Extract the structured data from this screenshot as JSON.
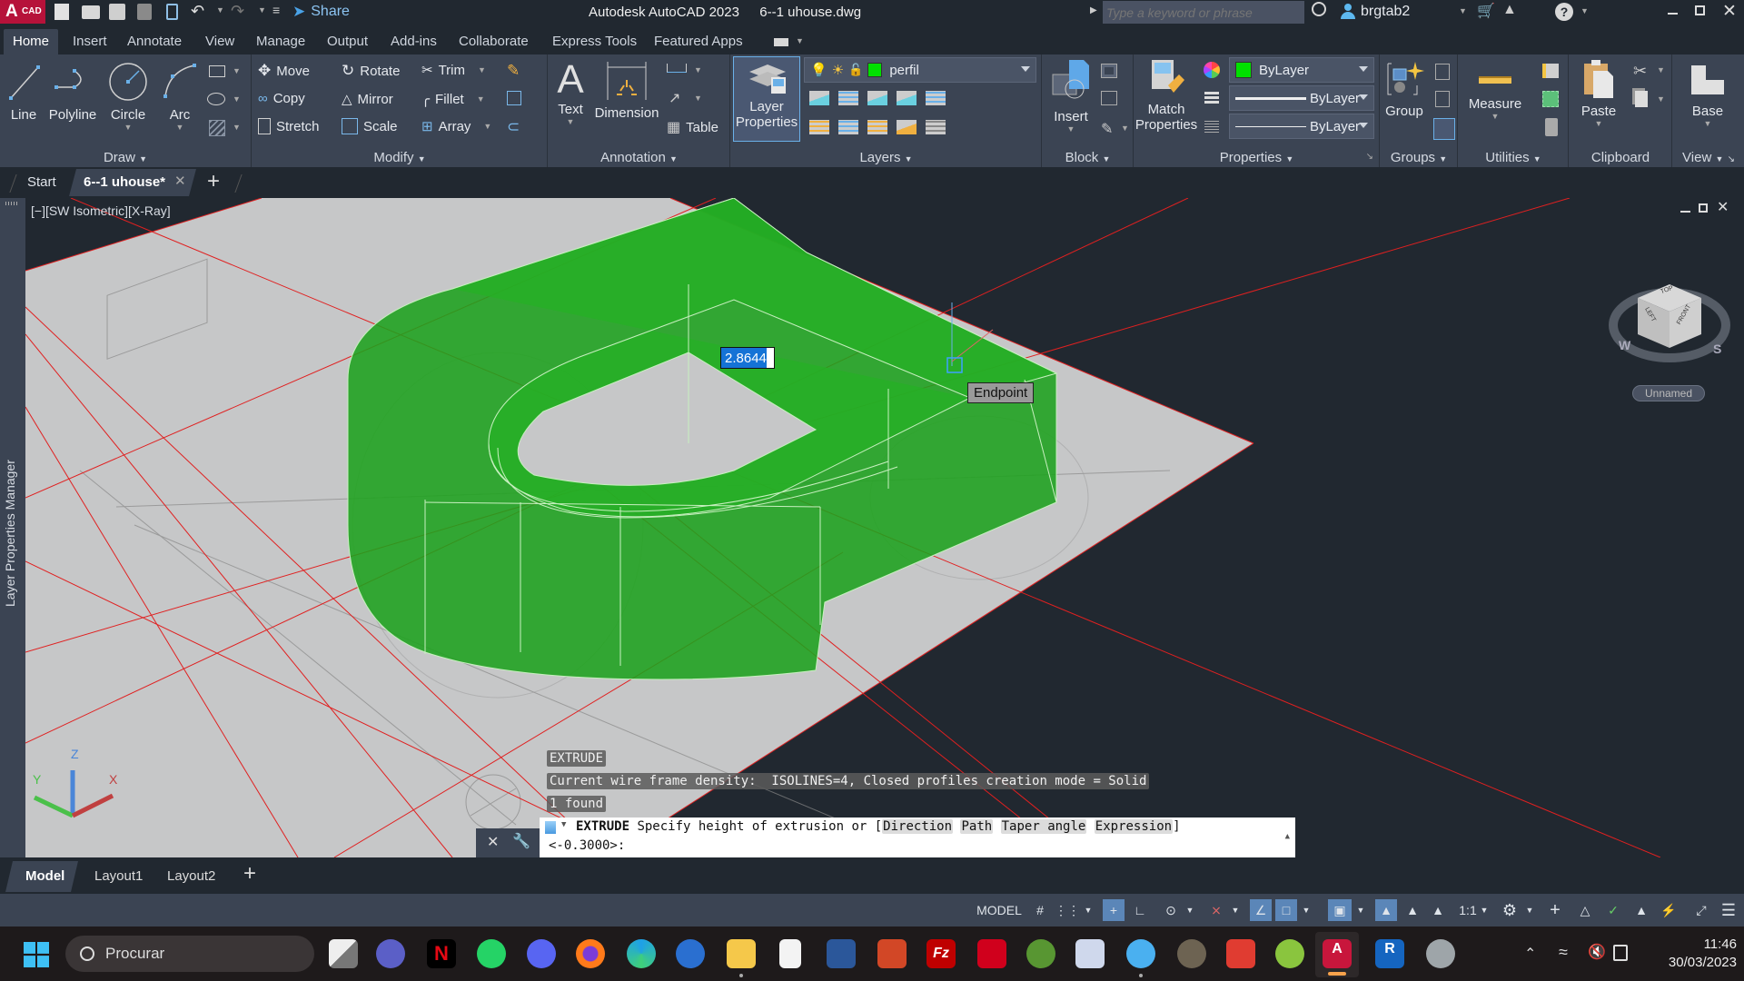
{
  "titlebar": {
    "app_badge": "A",
    "app_badge_sub": "CAD",
    "share_label": "Share",
    "title": "Autodesk AutoCAD 2023",
    "filename": "6--1 uhouse.dwg",
    "search_placeholder": "Type a keyword or phrase",
    "username": "brgtab2"
  },
  "ribbon_tabs": [
    "Home",
    "Insert",
    "Annotate",
    "View",
    "Manage",
    "Output",
    "Add-ins",
    "Collaborate",
    "Express Tools",
    "Featured Apps"
  ],
  "ribbon": {
    "draw": {
      "title": "Draw",
      "line": "Line",
      "polyline": "Polyline",
      "circle": "Circle",
      "arc": "Arc"
    },
    "modify": {
      "title": "Modify",
      "move": "Move",
      "rotate": "Rotate",
      "trim": "Trim",
      "copy": "Copy",
      "mirror": "Mirror",
      "fillet": "Fillet",
      "stretch": "Stretch",
      "scale": "Scale",
      "array": "Array"
    },
    "annotation": {
      "title": "Annotation",
      "text": "Text",
      "dimension": "Dimension",
      "table": "Table"
    },
    "layers": {
      "title": "Layers",
      "layer_properties_1": "Layer",
      "layer_properties_2": "Properties",
      "current_layer": "perfil",
      "layer_color": "#00e000"
    },
    "block": {
      "title": "Block",
      "insert": "Insert"
    },
    "properties": {
      "title": "Properties",
      "match_1": "Match",
      "match_2": "Properties",
      "color": "ByLayer",
      "lineweight": "ByLayer",
      "linetype": "ByLayer",
      "color_swatch": "#00e000"
    },
    "groups": {
      "title": "Groups",
      "group": "Group"
    },
    "utilities": {
      "title": "Utilities",
      "measure": "Measure"
    },
    "clipboard": {
      "title": "Clipboard",
      "paste": "Paste"
    },
    "view": {
      "title": "View",
      "base": "Base"
    }
  },
  "doc_tabs": {
    "start": "Start",
    "active": "6--1 uhouse*"
  },
  "side_palette": {
    "label": "Layer Properties Manager"
  },
  "viewport": {
    "label": "[−][SW Isometric][X-Ray]",
    "dynamic_input": "2.8644",
    "snap_tooltip": "Endpoint",
    "viewcube": {
      "top": "TOP",
      "left": "LEFT",
      "front": "FRONT",
      "compass_w": "W",
      "compass_s": "S",
      "ucs_name": "Unnamed"
    },
    "ucs": {
      "x": "X",
      "y": "Y",
      "z": "Z"
    },
    "accent_green": "#1fa51f",
    "accent_red": "#e02020"
  },
  "command": {
    "history": [
      "EXTRUDE",
      "Current wire frame density:  ISOLINES=4, Closed profiles creation mode = Solid",
      "1 found"
    ],
    "prompt_cmd": "EXTRUDE",
    "prompt_text": "Specify height of extrusion or [",
    "options": [
      "Direction",
      "Path",
      "Taper angle",
      "Expression"
    ],
    "prompt_close": "]",
    "default_value": "<-0.3000>:"
  },
  "layout_tabs": [
    "Model",
    "Layout1",
    "Layout2"
  ],
  "statusbar": {
    "model": "MODEL",
    "scale": "1:1"
  },
  "taskbar": {
    "search": "Procurar",
    "time": "11:46",
    "date": "30/03/2023",
    "apps": [
      "task-view",
      "teams",
      "netflix",
      "whatsapp",
      "discord",
      "firefox",
      "edge",
      "thunderbird",
      "file-explorer",
      "libreoffice",
      "word",
      "powerpoint",
      "filezilla",
      "rar",
      "qgis",
      "virtualbox",
      "paint",
      "gimp",
      "sketchup",
      "wine",
      "autocad",
      "revit",
      "google-earth-pro"
    ]
  }
}
